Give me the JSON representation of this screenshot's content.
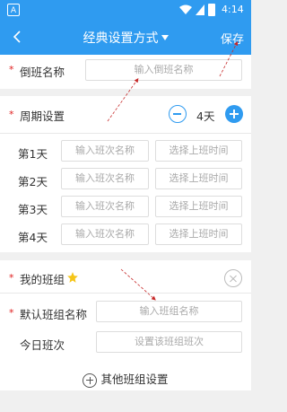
{
  "status_bar": {
    "app_badge": "A",
    "time": "4:14",
    "icons": [
      "wifi-icon",
      "signal-icon",
      "battery-icon"
    ]
  },
  "app_bar": {
    "title": "经典设置方式",
    "save_label": "保存"
  },
  "shift_name": {
    "required_mark": "*",
    "label": "倒班名称",
    "placeholder": "输入倒班名称"
  },
  "cycle": {
    "required_mark": "*",
    "label": "周期设置",
    "days_value": "4天",
    "days": [
      {
        "label": "第1天",
        "name_placeholder": "输入班次名称",
        "time_placeholder": "选择上班时间"
      },
      {
        "label": "第2天",
        "name_placeholder": "输入班次名称",
        "time_placeholder": "选择上班时间"
      },
      {
        "label": "第3天",
        "name_placeholder": "输入班次名称",
        "time_placeholder": "选择上班时间"
      },
      {
        "label": "第4天",
        "name_placeholder": "输入班次名称",
        "time_placeholder": "选择上班时间"
      }
    ]
  },
  "my_group": {
    "required_mark": "*",
    "label": "我的班组",
    "default_group_label": "默认班组名称",
    "default_group_placeholder": "输入班组名称",
    "today_shift_label": "今日班次",
    "today_shift_placeholder": "设置该班组班次",
    "other_groups_label": "其他班组设置"
  },
  "colors": {
    "accent": "#2f9bf0",
    "required": "#e02020",
    "annotation_arrow": "#c62828",
    "star": "#f5c518"
  }
}
